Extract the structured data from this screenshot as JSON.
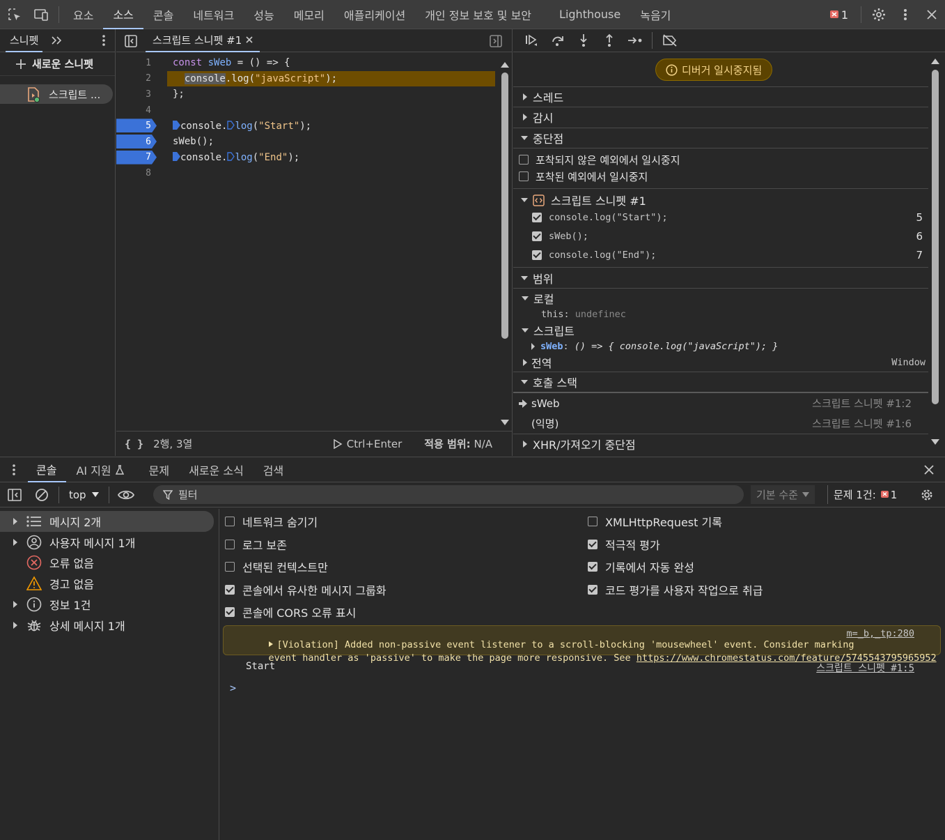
{
  "topbar": {
    "tabs": [
      "요소",
      "소스",
      "콘솔",
      "네트워크",
      "성능",
      "메모리",
      "애플리케이션",
      "개인 정보 보호 및 보안",
      "Lighthouse",
      "녹음기"
    ],
    "active_tab": 1,
    "issue_count": "1"
  },
  "navigator": {
    "tab_label": "스니펫",
    "new_snippet_label": "새로운 스니펫",
    "snippet_item": "스크립트 ..."
  },
  "editor": {
    "tab_label": "스크립트 스니펫 #1",
    "lines": [
      {
        "n": "1",
        "bp": false
      },
      {
        "n": "2",
        "bp": false
      },
      {
        "n": "3",
        "bp": false
      },
      {
        "n": "4",
        "bp": false
      },
      {
        "n": "5",
        "bp": true
      },
      {
        "n": "6",
        "bp": true
      },
      {
        "n": "7",
        "bp": true
      },
      {
        "n": "8",
        "bp": false
      }
    ],
    "status": {
      "position": "2행, 3열",
      "run_label": "Ctrl+Enter",
      "coverage_label": "적용 범위:",
      "coverage_value": "N/A"
    }
  },
  "debugger": {
    "paused_label": "디버거 일시중지됨",
    "sections": {
      "threads": "스레드",
      "watch": "감시",
      "breakpoints": "중단점",
      "scope": "범위",
      "callstack": "호출 스택",
      "xhr": "XHR/가져오기 중단점"
    },
    "pause_uncaught": "포착되지 않은 예외에서 일시중지",
    "pause_caught": "포착된 예외에서 일시중지",
    "bp_file": "스크립트 스니펫 #1",
    "bp_items": [
      {
        "code": "console.log(\"Start\");",
        "line": "5"
      },
      {
        "code": "sWeb();",
        "line": "6"
      },
      {
        "code": "console.log(\"End\");",
        "line": "7"
      }
    ],
    "scope": {
      "local": "로컬",
      "this_key": "this",
      "this_val": "undefinec",
      "script": "스크립트",
      "sweb_key": "sWeb",
      "sweb_val": "() => { console.log(\"javaScript\"); }",
      "global": "전역",
      "global_val": "Window"
    },
    "callstack": [
      {
        "name": "sWeb",
        "loc": "스크립트 스니펫 #1:2"
      },
      {
        "name": "(익명)",
        "loc": "스크립트 스니펫 #1:6"
      }
    ]
  },
  "drawer": {
    "tabs": [
      "콘솔",
      "AI 지원",
      "문제",
      "새로운 소식",
      "검색"
    ],
    "context": "top",
    "filter_placeholder": "필터",
    "level": "기본 수준",
    "issues_label": "문제 1건:",
    "issues_count": "1",
    "sidebar": [
      {
        "label": "메시지 2개",
        "icon": "list-icon",
        "expand": true,
        "selected": true
      },
      {
        "label": "사용자 메시지 1개",
        "icon": "user-icon",
        "expand": true,
        "selected": false
      },
      {
        "label": "오류 없음",
        "icon": "error-icon",
        "expand": false,
        "selected": false
      },
      {
        "label": "경고 없음",
        "icon": "warning-icon",
        "expand": false,
        "selected": false
      },
      {
        "label": "정보 1건",
        "icon": "info-icon",
        "expand": true,
        "selected": false
      },
      {
        "label": "상세 메시지 1개",
        "icon": "bug-icon",
        "expand": true,
        "selected": false
      }
    ],
    "settings_left": [
      {
        "label": "네트워크 숨기기",
        "checked": false
      },
      {
        "label": "로그 보존",
        "checked": false
      },
      {
        "label": "선택된 컨텍스트만",
        "checked": false
      },
      {
        "label": "콘솔에서 유사한 메시지 그룹화",
        "checked": true
      },
      {
        "label": "콘솔에 CORS 오류 표시",
        "checked": true
      }
    ],
    "settings_right": [
      {
        "label": "XMLHttpRequest 기록",
        "checked": false
      },
      {
        "label": "적극적 평가",
        "checked": true
      },
      {
        "label": "기록에서 자동 완성",
        "checked": true
      },
      {
        "label": "코드 평가를 사용자 작업으로 취급",
        "checked": true
      }
    ],
    "violation": {
      "line1": "[Violation] Added non-passive event listener to a scroll-blocking 'mousewheel' event. Consider marking",
      "line2": "event handler as 'passive' to make the page more responsive. See",
      "url": "https://www.chromestatus.com/feature/5745543795965952",
      "source": "m=_b,_tp:280"
    },
    "log": {
      "text": "Start",
      "source": "스크립트 스니펫 #1:5"
    },
    "prompt": ">"
  }
}
